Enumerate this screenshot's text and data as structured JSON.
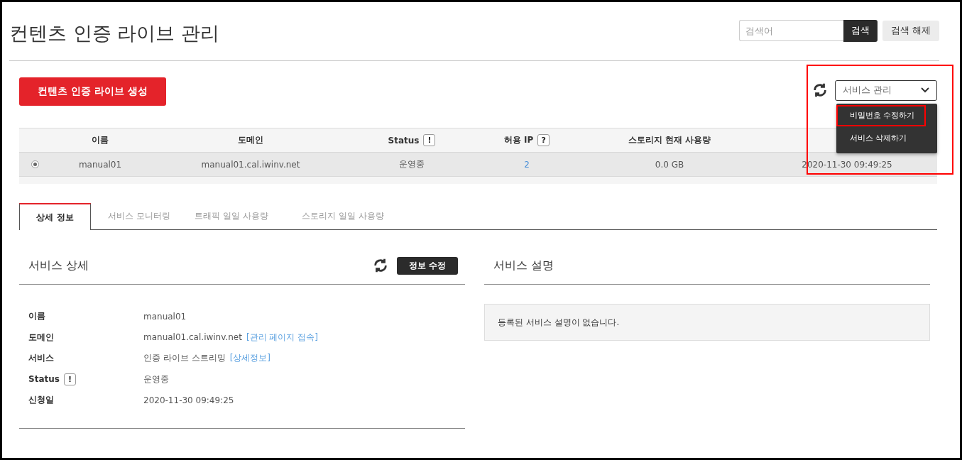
{
  "page": {
    "title": "컨텐츠 인증 라이브 관리"
  },
  "search": {
    "placeholder": "검색어",
    "button": "검색",
    "reset": "검색 해제"
  },
  "create_button": "컨텐츠 인증 라이브 생성",
  "service_menu": {
    "label": "서비스 관리",
    "expanded": true,
    "highlighted": true,
    "items": [
      {
        "label": "비밀번호 수정하기",
        "highlighted": true
      },
      {
        "label": "서비스 삭제하기",
        "highlighted": false
      }
    ]
  },
  "table": {
    "columns": [
      {
        "label": "이름"
      },
      {
        "label": "도메인"
      },
      {
        "label": "Status",
        "badge": "!"
      },
      {
        "label": "허용 IP",
        "badge": "?"
      },
      {
        "label": "스토리지 현재 사용량"
      }
    ],
    "rows": [
      {
        "selected": true,
        "cells": [
          {
            "text": "manual01",
            "kind": "text"
          },
          {
            "text": "manual01.cal.iwinv.net",
            "kind": "text"
          },
          {
            "text": "운영중",
            "kind": "text"
          },
          {
            "text": "2",
            "kind": "link"
          },
          {
            "text": "0.0 GB",
            "kind": "text"
          },
          {
            "text": "2020-11-30 09:49:25",
            "kind": "text"
          }
        ]
      }
    ]
  },
  "tabs": [
    {
      "label": "상세 정보",
      "selected": true
    },
    {
      "label": "서비스 모니터링",
      "selected": false
    },
    {
      "label": "트래픽 일일 사용량",
      "selected": false
    },
    {
      "label": "스토리지 일일 사용량",
      "selected": false
    }
  ],
  "detail": {
    "title": "서비스 상세",
    "edit_button": "정보 수정",
    "fields": [
      {
        "label": "이름",
        "value": "manual01"
      },
      {
        "label": "도메인",
        "value": "manual01.cal.iwinv.net",
        "link": "[관리 페이지 접속]"
      },
      {
        "label": "서비스",
        "value": "인증 라이브 스트리밍",
        "link": "[상세정보]"
      },
      {
        "label": "Status",
        "badge": "!",
        "value": "운영중"
      },
      {
        "label": "신청일",
        "value": "2020-11-30 09:49:25"
      }
    ]
  },
  "description": {
    "title": "서비스 설명",
    "text": "등록된 서비스 설명이 없습니다."
  }
}
